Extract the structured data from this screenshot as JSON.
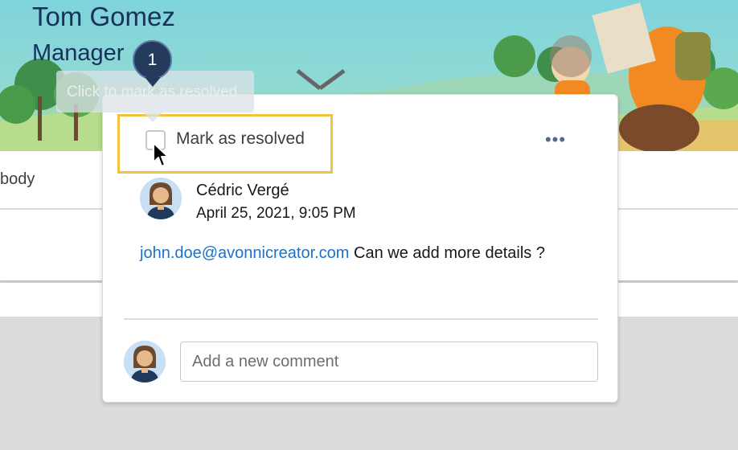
{
  "profile": {
    "name": "Tom Gomez",
    "title": "Manager"
  },
  "page": {
    "body_text": "body"
  },
  "tooltip": {
    "step_number": "1",
    "text": "Click to mark as resolved"
  },
  "comment_popover": {
    "resolve_label": "Mark as resolved",
    "resolved": false,
    "more_actions_icon": "ellipsis-icon",
    "author": "Cédric Vergé",
    "timestamp": "April 25, 2021, 9:05 PM",
    "mention": "john.doe@avonnicreator.com",
    "message": " Can we add more details ?",
    "new_comment_placeholder": "Add a new comment"
  },
  "colors": {
    "highlight": "#f2c43d",
    "link": "#1a73c8",
    "step_badge": "#243b5e"
  }
}
